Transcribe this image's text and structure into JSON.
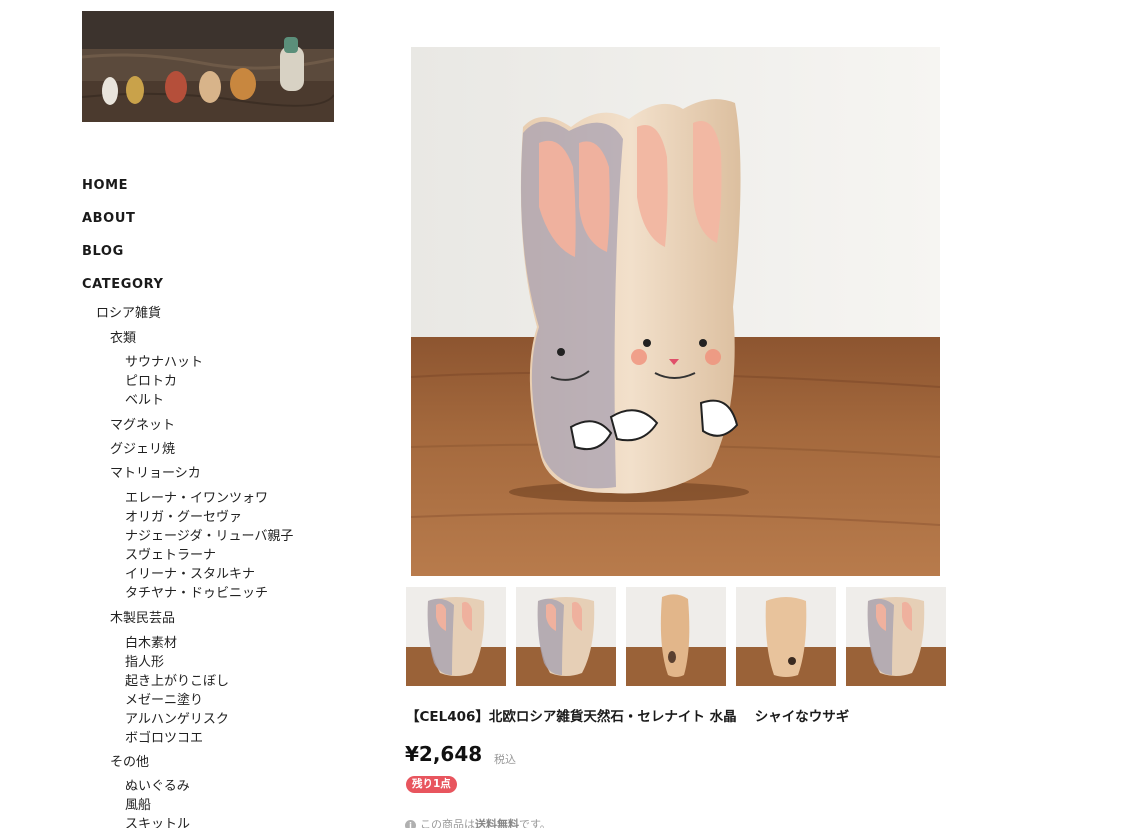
{
  "nav": {
    "home": "HOME",
    "about": "ABOUT",
    "blog": "BLOG",
    "category": "CATEGORY"
  },
  "categories": [
    {
      "label": "ロシア雑貨",
      "level": 1
    },
    {
      "label": "衣類",
      "level": 2
    },
    {
      "label": "サウナハット",
      "level": 3
    },
    {
      "label": "ピロトカ",
      "level": 3
    },
    {
      "label": "ベルト",
      "level": 3
    },
    {
      "label": "マグネット",
      "level": 2
    },
    {
      "label": "グジェリ焼",
      "level": 2
    },
    {
      "label": "マトリョーシカ",
      "level": 2
    },
    {
      "label": "エレーナ・イワンツォワ",
      "level": 3
    },
    {
      "label": "オリガ・グーセヴァ",
      "level": 3
    },
    {
      "label": "ナジェージダ・リューバ親子",
      "level": 3
    },
    {
      "label": "スヴェトラーナ",
      "level": 3
    },
    {
      "label": "イリーナ・スタルキナ",
      "level": 3
    },
    {
      "label": "タチヤナ・ドゥビニッチ",
      "level": 3
    },
    {
      "label": "木製民芸品",
      "level": 2
    },
    {
      "label": "白木素材",
      "level": 3
    },
    {
      "label": "指人形",
      "level": 3
    },
    {
      "label": "起き上がりこぼし",
      "level": 3
    },
    {
      "label": "メゼーニ塗り",
      "level": 3
    },
    {
      "label": "アルハンゲリスク",
      "level": 3
    },
    {
      "label": "ボゴロツコエ",
      "level": 3
    },
    {
      "label": "その他",
      "level": 2
    },
    {
      "label": "ぬいぐるみ",
      "level": 3
    },
    {
      "label": "風船",
      "level": 3
    },
    {
      "label": "スキットル",
      "level": 3
    }
  ],
  "product": {
    "title": "【CEL406】北欧ロシア雑貨天然石・セレナイト 水晶　 シャイなウサギ",
    "price": "¥2,648",
    "tax_label": "税込",
    "stock_badge": "残り1点",
    "shipping_prefix": "この商品は",
    "shipping_strong": "送料無料",
    "shipping_suffix": "です。",
    "info_icon_glyph": "i"
  },
  "colors": {
    "badge": "#e8555e",
    "wall": "#f2f1ee",
    "table": "#9a6238"
  }
}
